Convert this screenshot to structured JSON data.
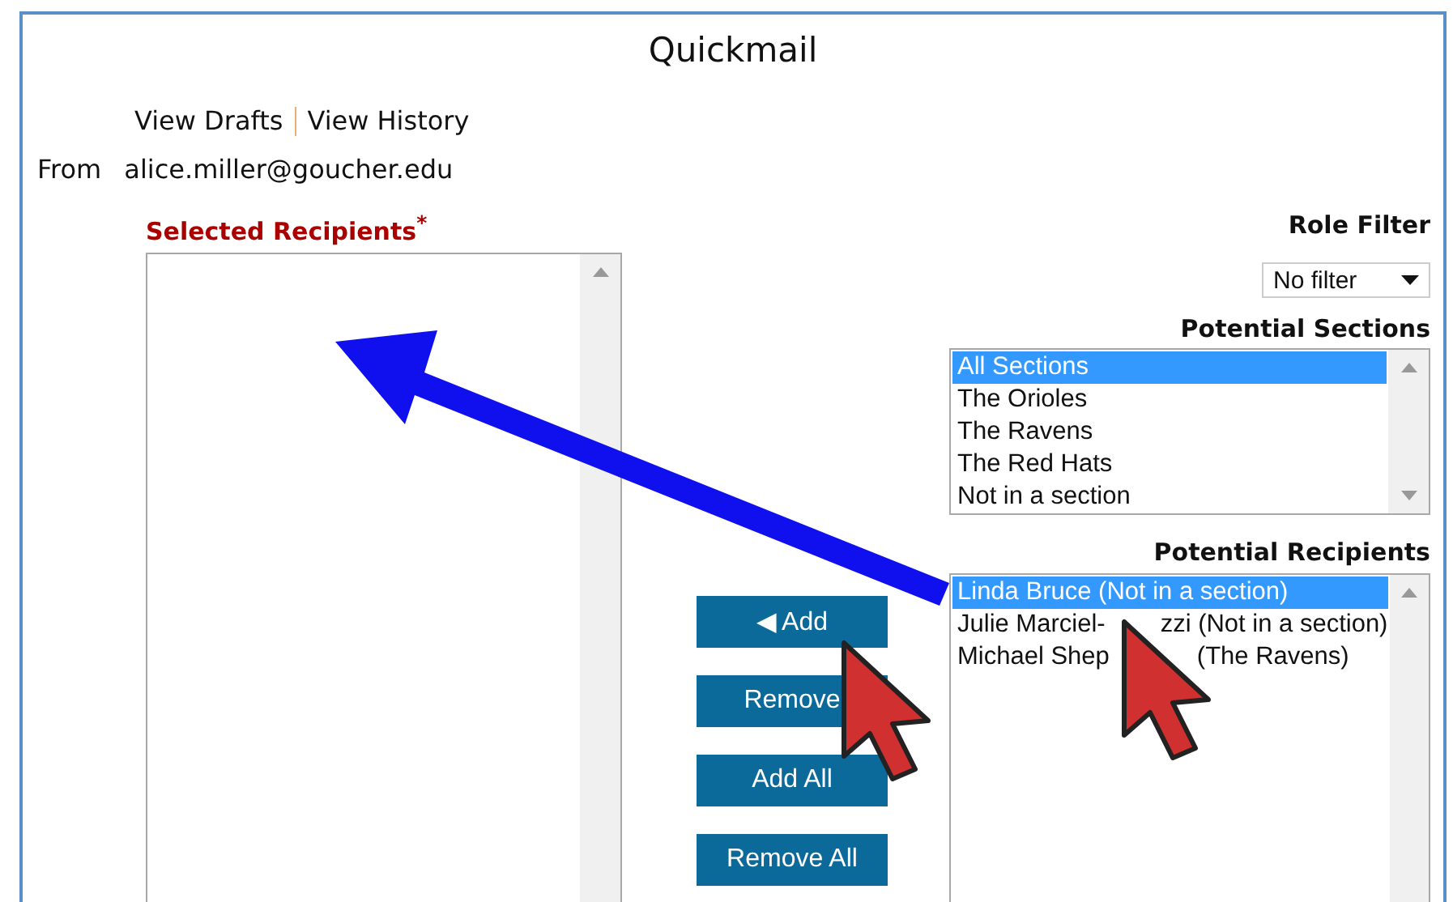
{
  "title": "Quickmail",
  "links": [
    "View Drafts",
    "View History"
  ],
  "from": {
    "label": "From",
    "value": "alice.miller@goucher.edu"
  },
  "selected_recipients": {
    "label": "Selected Recipients",
    "required_mark": "*"
  },
  "role_filter": {
    "label": "Role Filter",
    "value": "No filter"
  },
  "potential_sections": {
    "label": "Potential Sections",
    "items": [
      {
        "text": "All Sections",
        "selected": true
      },
      {
        "text": "The Orioles",
        "selected": false
      },
      {
        "text": "The Ravens",
        "selected": false
      },
      {
        "text": "The Red Hats",
        "selected": false
      },
      {
        "text": "Not in a section",
        "selected": false
      }
    ]
  },
  "potential_recipients": {
    "label": "Potential Recipients",
    "items": [
      {
        "parts": [
          "Linda Bruce (Not in a section)"
        ],
        "selected": true
      },
      {
        "parts": [
          "Julie Marciel-",
          "zzi (Not in a section)"
        ],
        "selected": false
      },
      {
        "parts": [
          "Michael Shep",
          "(The Ravens)"
        ],
        "selected": false
      }
    ]
  },
  "buttons": [
    "◀ Add",
    "Remove",
    "Add All",
    "Remove All"
  ]
}
